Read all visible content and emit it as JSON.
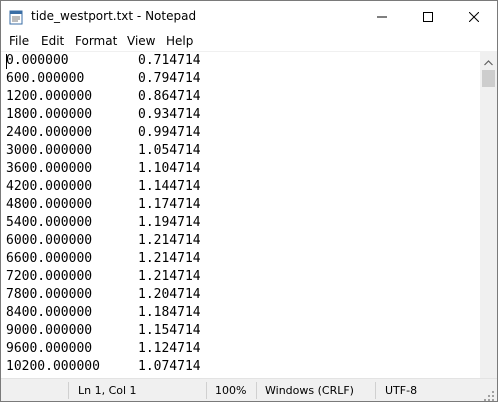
{
  "window": {
    "title": "tide_westport.txt - Notepad",
    "icons": {
      "app": "notepad-icon",
      "minimize": "minimize-icon",
      "maximize": "maximize-icon",
      "close": "close-icon"
    }
  },
  "menu": {
    "items": [
      "File",
      "Edit",
      "Format",
      "View",
      "Help"
    ]
  },
  "editor": {
    "lines": [
      {
        "time": "0.000000",
        "value": "0.714714"
      },
      {
        "time": "600.000000",
        "value": "0.794714"
      },
      {
        "time": "1200.000000",
        "value": "0.864714"
      },
      {
        "time": "1800.000000",
        "value": "0.934714"
      },
      {
        "time": "2400.000000",
        "value": "0.994714"
      },
      {
        "time": "3000.000000",
        "value": "1.054714"
      },
      {
        "time": "3600.000000",
        "value": "1.104714"
      },
      {
        "time": "4200.000000",
        "value": "1.144714"
      },
      {
        "time": "4800.000000",
        "value": "1.174714"
      },
      {
        "time": "5400.000000",
        "value": "1.194714"
      },
      {
        "time": "6000.000000",
        "value": "1.214714"
      },
      {
        "time": "6600.000000",
        "value": "1.214714"
      },
      {
        "time": "7200.000000",
        "value": "1.214714"
      },
      {
        "time": "7800.000000",
        "value": "1.204714"
      },
      {
        "time": "8400.000000",
        "value": "1.184714"
      },
      {
        "time": "9000.000000",
        "value": "1.154714"
      },
      {
        "time": "9600.000000",
        "value": "1.124714"
      },
      {
        "time": "10200.000000",
        "value": "1.074714"
      }
    ]
  },
  "scrollbar": {
    "up_icon": "scroll-up-arrow-icon"
  },
  "status": {
    "position": "Ln 1, Col 1",
    "zoom": "100%",
    "line_ending": "Windows (CRLF)",
    "encoding": "UTF-8",
    "grip_icon": "resize-grip-icon"
  }
}
